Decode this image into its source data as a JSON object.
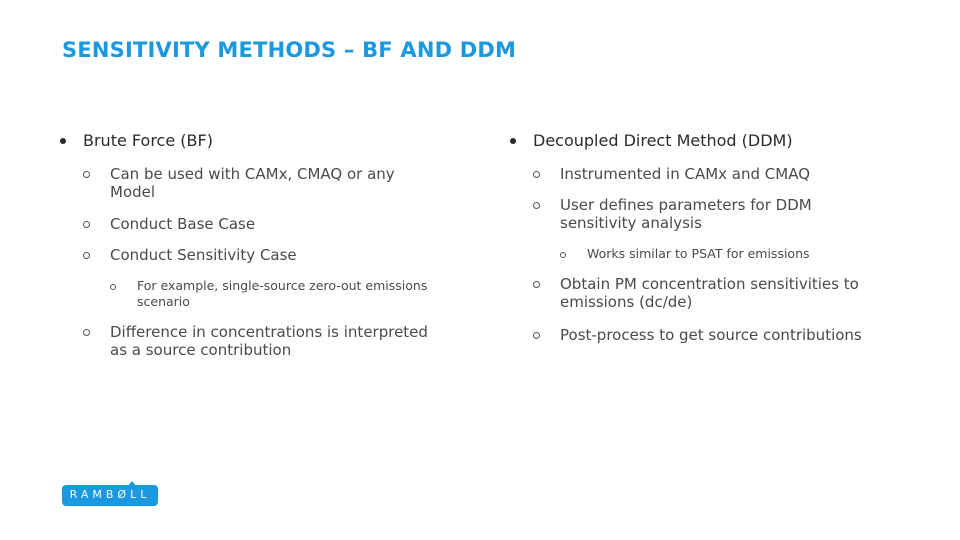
{
  "slide": {
    "title": "SENSITIVITY METHODS – BF AND DDM",
    "accent_color": "#1a98e0",
    "left_column": {
      "heading": "Brute Force (BF)",
      "items": [
        {
          "line1": "Can be used with CAMx, CMAQ or any",
          "line2": "Model"
        },
        {
          "line1": "Conduct Base Case",
          "line2": ""
        },
        {
          "line1": "Conduct Sensitivity Case",
          "line2": ""
        },
        {
          "line1": "Difference in concentrations is interpreted",
          "line2": "as a source contribution"
        }
      ],
      "subitems": [
        {
          "line1": "For example, single-source zero-out emissions",
          "line2": "scenario"
        }
      ]
    },
    "right_column": {
      "heading": "Decoupled Direct Method (DDM)",
      "items": [
        {
          "line1": "Instrumented in CAMx and CMAQ",
          "line2": ""
        },
        {
          "line1": "User defines parameters for DDM",
          "line2": "sensitivity analysis"
        },
        {
          "line1": "Obtain PM concentration sensitivities to",
          "line2": "emissions (dc/de)"
        },
        {
          "line1": "Post-process to get source contributions",
          "line2": ""
        }
      ],
      "subitems": [
        {
          "line1": "Works similar to PSAT for emissions",
          "line2": ""
        }
      ]
    },
    "logo": {
      "text": "RAMBØLL"
    }
  }
}
